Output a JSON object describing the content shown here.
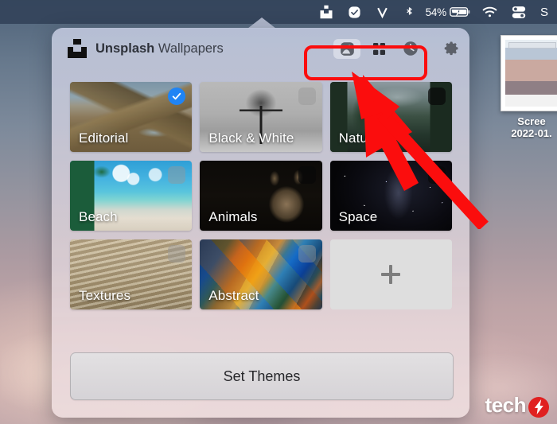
{
  "menubar": {
    "items": [
      {
        "name": "unsplash-menubar-icon",
        "icon": "unsplash-icon",
        "label": ""
      },
      {
        "name": "todo-menubar-icon",
        "icon": "check-circle-icon",
        "label": ""
      },
      {
        "name": "vpn-menubar-icon",
        "icon": "letter-v-icon",
        "label": "V"
      },
      {
        "name": "bluetooth-menubar-icon",
        "icon": "bluetooth-icon",
        "label": ""
      }
    ],
    "battery_percent": "54%",
    "battery_icon": "battery-charging-icon",
    "wifi_icon": "wifi-icon",
    "control_center_icon": "control-center-icon",
    "spotlight_icon": "spotlight-search-icon",
    "spotlight_label": "S"
  },
  "popover": {
    "brand_bold": "Unsplash",
    "brand_regular": " Wallpapers",
    "logo_icon": "unsplash-logo-icon",
    "toolbar": {
      "buttons": [
        {
          "name": "tab-photos",
          "icon": "photo-icon",
          "active": true
        },
        {
          "name": "tab-collections",
          "icon": "grid-four-squares-icon",
          "active": false
        },
        {
          "name": "tab-history",
          "icon": "clock-icon",
          "active": false
        }
      ],
      "settings_icon": "gear-icon"
    },
    "themes": [
      {
        "label": "Editorial",
        "art": "art-editorial",
        "badge": "on"
      },
      {
        "label": "Black & White",
        "art": "art-bw",
        "badge": "off"
      },
      {
        "label": "Nature",
        "art": "art-nature",
        "badge": "dark"
      },
      {
        "label": "Beach",
        "art": "art-beach",
        "badge": "off"
      },
      {
        "label": "Animals",
        "art": "art-animals",
        "badge": "dark"
      },
      {
        "label": "Space",
        "art": "art-space",
        "badge": "dark"
      },
      {
        "label": "Textures",
        "art": "art-textures",
        "badge": "off"
      },
      {
        "label": "Abstract",
        "art": "art-abstract",
        "badge": "off"
      }
    ],
    "add_tile_icon": "plus-icon",
    "set_themes_label": "Set Themes"
  },
  "desktop": {
    "file_icon": {
      "name_line1": "Scree",
      "name_line2": "2022-01."
    }
  },
  "annotations": {
    "highlight_box_color": "#fb0d0d",
    "arrow_color": "#fb0d0d",
    "arrow_points_to": "tab-history"
  },
  "watermark": {
    "text": "tech",
    "badge_icon": "lightning-bolt-icon",
    "badge_color": "#e02020"
  }
}
